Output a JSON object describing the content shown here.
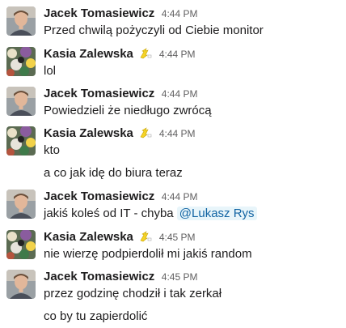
{
  "messages": [
    {
      "author": "Jacek Tomasiewicz",
      "avatar": "jacek-avatar",
      "time": "4:44 PM",
      "lines": [
        "Przed chwilą pożyczyli od Ciebie monitor"
      ]
    },
    {
      "author": "Kasia Zalewska",
      "avatar": "kasia-avatar",
      "status_icon": "pikachu-emoji-icon",
      "time": "4:44 PM",
      "lines": [
        "lol"
      ]
    },
    {
      "author": "Jacek Tomasiewicz",
      "avatar": "jacek-avatar",
      "time": "4:44 PM",
      "lines": [
        "Powiedzieli że niedługo zwrócą"
      ]
    },
    {
      "author": "Kasia Zalewska",
      "avatar": "kasia-avatar",
      "status_icon": "pikachu-emoji-icon",
      "time": "4:44 PM",
      "lines": [
        "kto",
        "a co jak idę do biura teraz"
      ]
    },
    {
      "author": "Jacek Tomasiewicz",
      "avatar": "jacek-avatar",
      "time": "4:44 PM",
      "lines": [
        "jakiś koleś od IT - chyba "
      ],
      "mention": "@Lukasz Rys"
    },
    {
      "author": "Kasia Zalewska",
      "avatar": "kasia-avatar",
      "status_icon": "pikachu-emoji-icon",
      "time": "4:45 PM",
      "lines": [
        "nie wierzę podpierdolił mi jakiś random"
      ]
    },
    {
      "author": "Jacek Tomasiewicz",
      "avatar": "jacek-avatar",
      "time": "4:45 PM",
      "lines": [
        "przez godzinę chodził i tak zerkał",
        "co by tu zapierdolić"
      ]
    }
  ],
  "colors": {
    "mention_bg": "#e8f5fa",
    "mention_text": "#1264a3",
    "timestamp": "#616061",
    "text": "#1d1c1d"
  }
}
